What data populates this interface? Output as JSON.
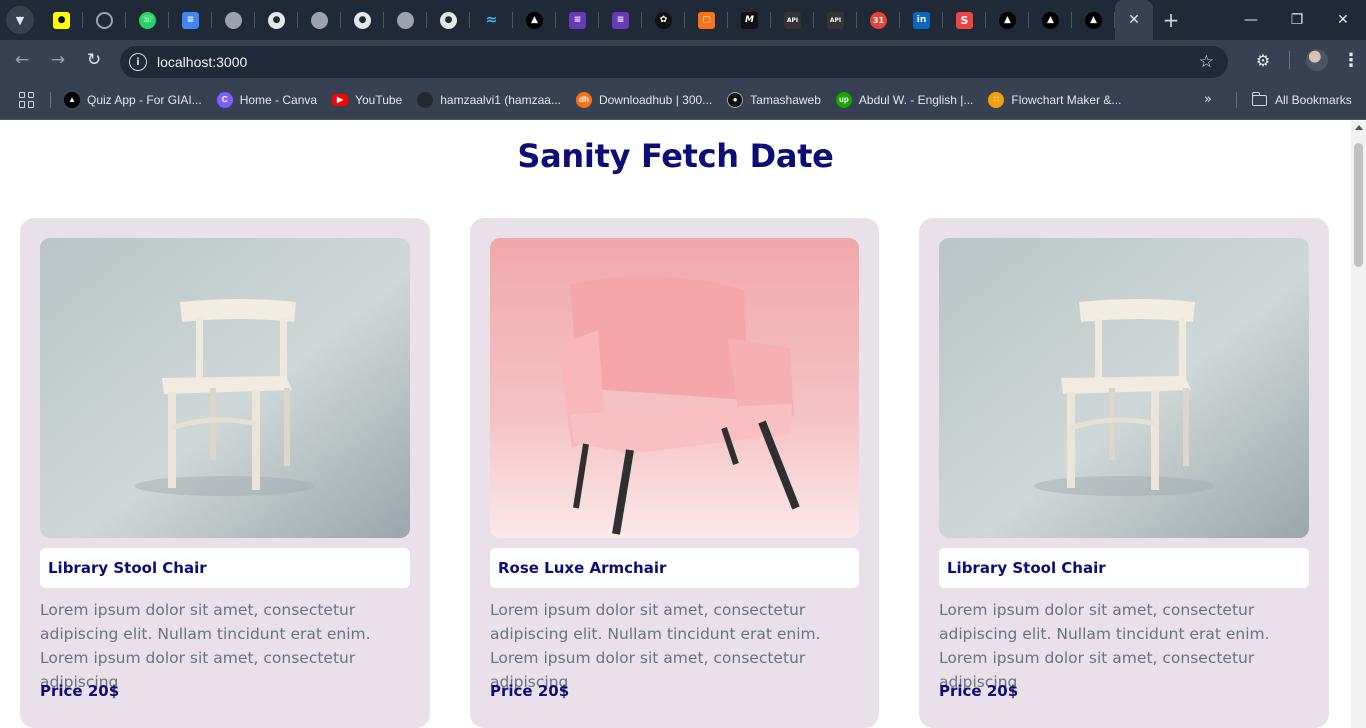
{
  "browser": {
    "tabs": [
      {
        "icon": "snapchat-icon",
        "color": "#fffc00"
      },
      {
        "icon": "whatsapp-icon",
        "color": "#9ca3af"
      },
      {
        "icon": "whatsapp-icon",
        "color": "#25d366"
      },
      {
        "icon": "google-docs-icon",
        "color": "#4285f4"
      },
      {
        "icon": "globe-icon",
        "color": "#9ca3af"
      },
      {
        "icon": "github-icon",
        "color": "#e5e7eb"
      },
      {
        "icon": "globe-icon",
        "color": "#9ca3af"
      },
      {
        "icon": "github-icon",
        "color": "#e5e7eb"
      },
      {
        "icon": "globe-icon",
        "color": "#9ca3af"
      },
      {
        "icon": "github-icon",
        "color": "#e5e7eb"
      },
      {
        "icon": "tailwind-icon",
        "color": "#38bdf8"
      },
      {
        "icon": "vercel-icon",
        "color": "#000000"
      },
      {
        "icon": "forms-icon",
        "color": "#673ab7"
      },
      {
        "icon": "forms-icon",
        "color": "#673ab7"
      },
      {
        "icon": "openai-icon",
        "color": "#111111"
      },
      {
        "icon": "box-icon",
        "color": "#f97316"
      },
      {
        "icon": "medium-icon",
        "color": "#111111"
      },
      {
        "icon": "mockapi-icon",
        "color": "#333333"
      },
      {
        "icon": "mockapi-icon",
        "color": "#333333"
      },
      {
        "icon": "calendar-icon",
        "color": "#ea4335"
      },
      {
        "icon": "linkedin-icon",
        "color": "#0a66c2"
      },
      {
        "icon": "s-icon",
        "color": "#ef4444"
      },
      {
        "icon": "vercel-icon",
        "color": "#000000"
      },
      {
        "icon": "vercel-icon",
        "color": "#000000"
      },
      {
        "icon": "vercel-icon",
        "color": "#000000"
      }
    ],
    "tab_badges": {
      "calendar": "31",
      "linkedin": "in",
      "s": "S",
      "mock": "API",
      "medium": "M"
    },
    "url": "localhost:3000",
    "bookmarks": [
      {
        "label": "Quiz App - For GIAI...",
        "icon": "vercel-icon",
        "color": "#000000"
      },
      {
        "label": "Home - Canva",
        "icon": "canva-icon",
        "color": "#7b61ff"
      },
      {
        "label": "YouTube",
        "icon": "youtube-icon",
        "color": "#ff0000"
      },
      {
        "label": "hamzaalvi1 (hamzaa...",
        "icon": "github-icon",
        "color": "#24292f"
      },
      {
        "label": "Downloadhub | 300...",
        "icon": "downloadhub-icon",
        "color": "#f97316"
      },
      {
        "label": "Tamashaweb",
        "icon": "tamasha-icon",
        "color": "#111111"
      },
      {
        "label": "Abdul W. - English |...",
        "icon": "upwork-icon",
        "color": "#14a800"
      },
      {
        "label": "Flowchart Maker &...",
        "icon": "flowchart-icon",
        "color": "#f59e0b"
      }
    ],
    "all_bookmarks": "All Bookmarks"
  },
  "page": {
    "title": "Sanity Fetch Date",
    "accent_color": "#0d0d7a",
    "card_bg": "#e9e0ea",
    "products": [
      {
        "name": "Library Stool Chair",
        "description": "Lorem ipsum dolor sit amet, consectetur adipiscing elit. Nullam tincidunt erat enim. Lorem ipsum dolor sit amet, consectetur adipiscing",
        "price": "Price 20$",
        "image": "white-wooden-chair"
      },
      {
        "name": "Rose Luxe Armchair",
        "description": "Lorem ipsum dolor sit amet, consectetur adipiscing elit. Nullam tincidunt erat enim. Lorem ipsum dolor sit amet, consectetur adipiscing",
        "price": "Price 20$",
        "image": "pink-armchair"
      },
      {
        "name": "Library Stool Chair",
        "description": "Lorem ipsum dolor sit amet, consectetur adipiscing elit. Nullam tincidunt erat enim. Lorem ipsum dolor sit amet, consectetur adipiscing",
        "price": "Price 20$",
        "image": "white-wooden-chair"
      }
    ]
  }
}
